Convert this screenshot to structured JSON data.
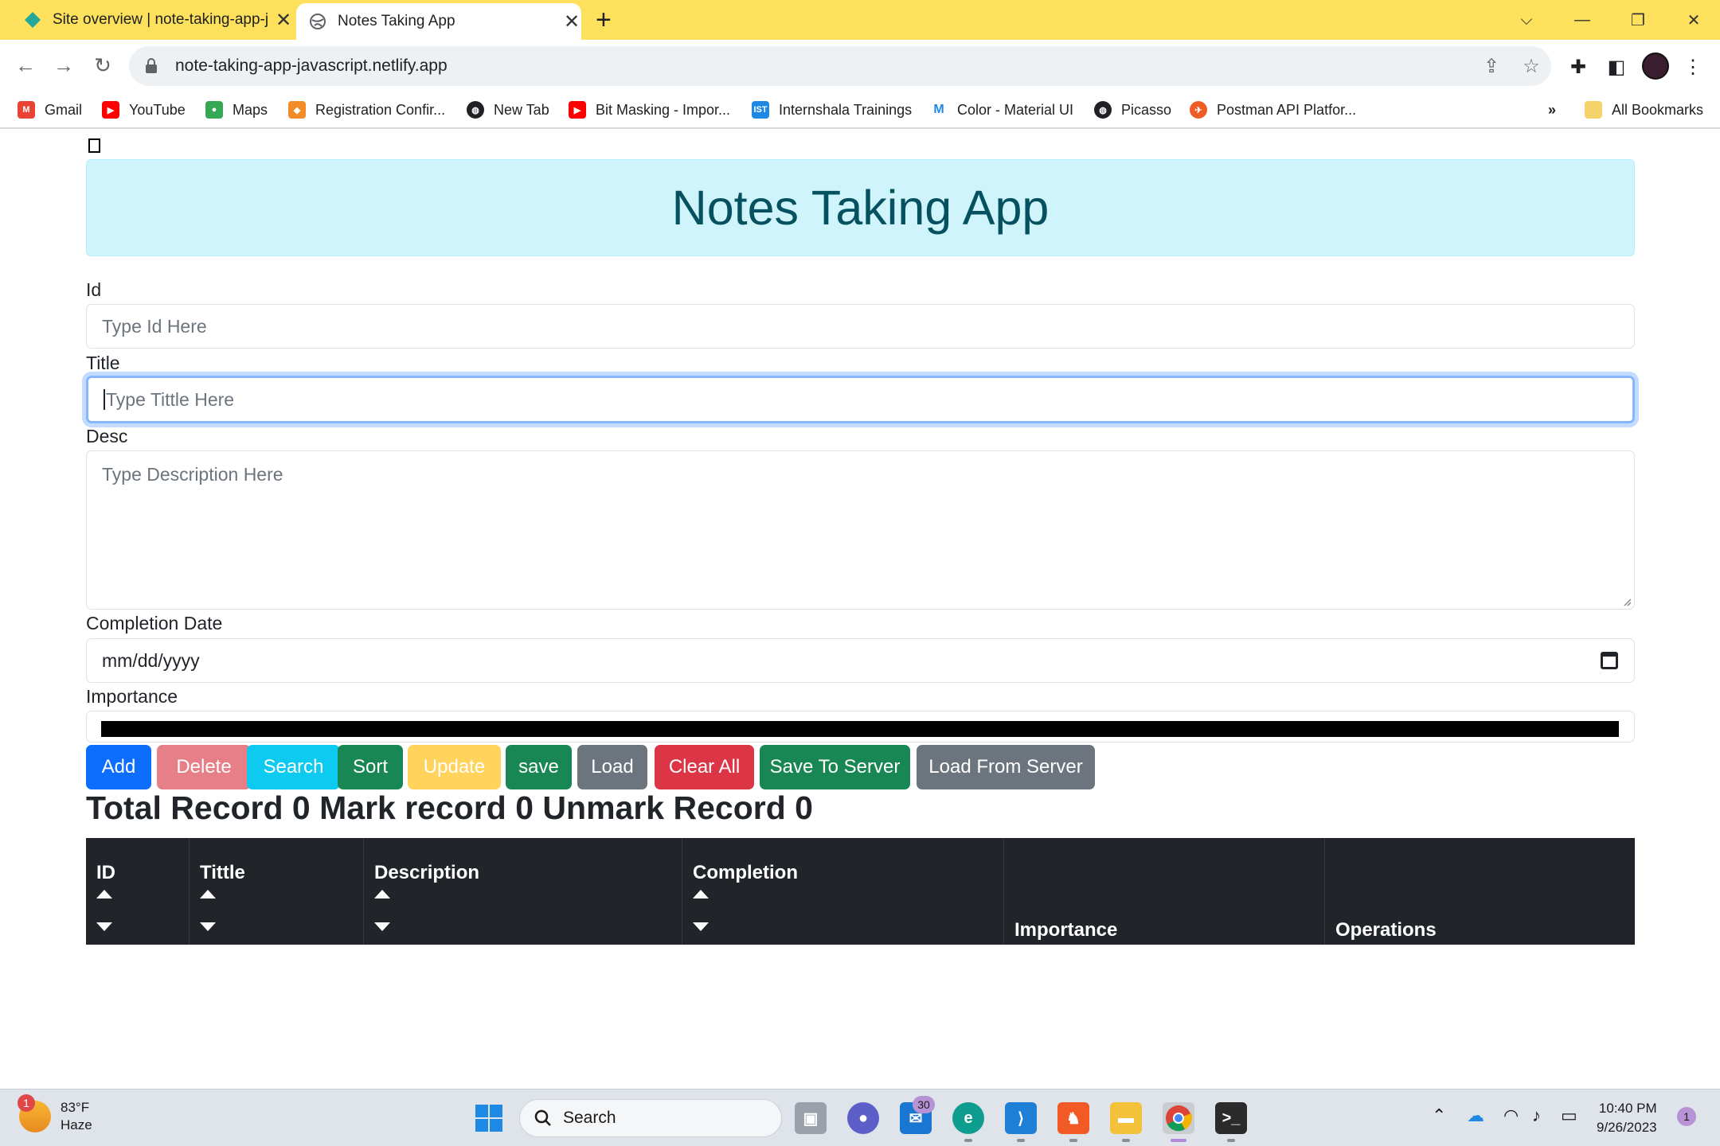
{
  "browser": {
    "tabs": [
      {
        "title": "Site overview | note-taking-app-j",
        "active": false
      },
      {
        "title": "Notes Taking App",
        "active": true
      }
    ],
    "url": "note-taking-app-javascript.netlify.app",
    "bookmarks": [
      {
        "label": "Gmail",
        "icon": "gmail-icon",
        "color": "#ea4335"
      },
      {
        "label": "YouTube",
        "icon": "youtube-icon",
        "color": "#ff0000"
      },
      {
        "label": "Maps",
        "icon": "maps-icon",
        "color": "#34a853"
      },
      {
        "label": "Registration Confir...",
        "icon": "registration-icon",
        "color": "#f28c28"
      },
      {
        "label": "New Tab",
        "icon": "globe-icon",
        "color": "#202124"
      },
      {
        "label": "Bit Masking - Impor...",
        "icon": "youtube-icon",
        "color": "#ff0000"
      },
      {
        "label": "Internshala Trainings",
        "icon": "internshala-icon",
        "color": "#1e88e5"
      },
      {
        "label": "Color - Material UI",
        "icon": "material-ui-icon",
        "color": "#1e88e5"
      },
      {
        "label": "Picasso",
        "icon": "globe-icon",
        "color": "#202124"
      },
      {
        "label": "Postman API Platfor...",
        "icon": "postman-icon",
        "color": "#ef5b25"
      }
    ],
    "overflow": "»",
    "all_bookmarks": "All Bookmarks"
  },
  "app": {
    "title": "Notes Taking App",
    "fields": {
      "id_label": "Id",
      "id_placeholder": "Type Id Here",
      "title_label": "Title",
      "title_placeholder": "Type Tittle Here",
      "desc_label": "Desc",
      "desc_placeholder": "Type Description Here",
      "date_label": "Completion Date",
      "date_placeholder": "mm/dd/yyyy",
      "importance_label": "Importance"
    },
    "buttons": [
      {
        "label": "Add",
        "color": "#0d6efd"
      },
      {
        "label": "Delete",
        "color": "#e77f89"
      },
      {
        "label": "Search",
        "color": "#0dcaf0"
      },
      {
        "label": "Sort",
        "color": "#198754"
      },
      {
        "label": "Update",
        "color": "#ffd35c"
      },
      {
        "label": "save",
        "color": "#198754"
      },
      {
        "label": "Load",
        "color": "#6c757d"
      },
      {
        "label": "Clear All",
        "color": "#dc3545"
      },
      {
        "label": "Save To Server",
        "color": "#198754"
      },
      {
        "label": "Load From Server",
        "color": "#6c757d"
      }
    ],
    "totals": "Total Record 0 Mark record 0 Unmark Record 0",
    "table_headers": [
      {
        "label": "ID",
        "sortable": true
      },
      {
        "label": "Tittle",
        "sortable": true
      },
      {
        "label": "Description",
        "sortable": true
      },
      {
        "label": "Completion",
        "sortable": true
      },
      {
        "label": "Importance",
        "sortable": false
      },
      {
        "label": "Operations",
        "sortable": false
      }
    ]
  },
  "taskbar": {
    "temperature": "83°F",
    "condition": "Haze",
    "weather_badge": "1",
    "search_label": "Search",
    "mail_badge": "30",
    "time": "10:40 PM",
    "date": "9/26/2023",
    "notification_count": "1"
  }
}
